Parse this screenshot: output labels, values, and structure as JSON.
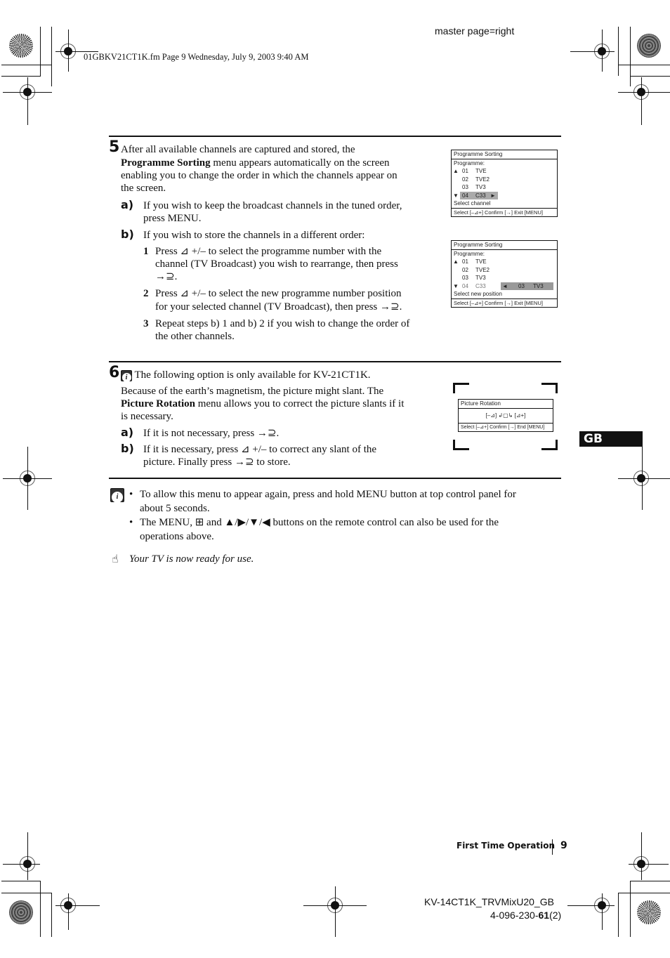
{
  "header": {
    "file_info": "01GBKV21CT1K.fm  Page 9  Wednesday, July 9, 2003  9:40 AM",
    "master_page": "master page=right"
  },
  "step5": {
    "number": "5",
    "intro_pre": "After all available channels are captured and stored, the",
    "intro_bold": "Programme Sorting",
    "intro_post1": " menu appears automatically on the screen",
    "intro_line3": "enabling you to change the order in which the channels appear on",
    "intro_line4": "the screen.",
    "a_label": "a)",
    "a_line1": "If you wish to keep the broadcast channels in the tuned order,",
    "a_line2": "press MENU.",
    "b_label": "b)",
    "b_text": "If you wish to store the channels in a different order:",
    "substeps": [
      {
        "num": "1",
        "line1": "Press ⊿ +/– to select the programme number with the",
        "line2": "channel (TV Broadcast) you wish to rearrange, then press",
        "line3": "→⊇."
      },
      {
        "num": "2",
        "line1": "Press ⊿ +/– to select the new programme number position",
        "line2": "for your selected channel (TV Broadcast), then press →⊇."
      },
      {
        "num": "3",
        "line1": "Repeat steps b) 1 and b) 2 if you wish to change the order of",
        "line2": "the other channels."
      }
    ]
  },
  "osd1": {
    "title": "Programme Sorting",
    "heading": "Programme:",
    "rows": [
      {
        "num": "01",
        "name": "TVE"
      },
      {
        "num": "02",
        "name": "TVE2"
      },
      {
        "num": "03",
        "name": "TV3"
      },
      {
        "num": "04",
        "name": "C33"
      }
    ],
    "status": "Select channel",
    "footer": "Select [–⊿+]  Confirm [→]  Exit [MENU]"
  },
  "osd2": {
    "title": "Programme Sorting",
    "heading": "Programme:",
    "rows": [
      {
        "num": "01",
        "name": "TVE"
      },
      {
        "num": "02",
        "name": "TVE2"
      },
      {
        "num": "03",
        "name": "TV3"
      },
      {
        "num": "04",
        "name": "C33"
      }
    ],
    "target_num": "03",
    "target_name": "TV3",
    "status": "Select new position",
    "footer": "Select [–⊿+]  Confirm [→]  Exit [MENU]"
  },
  "step6": {
    "number": "6",
    "note": "The following option is only available for KV-21CT1K.",
    "line1": "Because of the earth’s magnetism, the picture might slant. The",
    "line2_bold": "Picture Rotation",
    "line2_post": " menu allows you to correct the picture slants if it",
    "line3": "is necessary.",
    "a_label": "a)",
    "a_text": "If it is not necessary, press →⊇.",
    "b_label": "b)",
    "b_line1": "If it is necessary, press ⊿ +/– to correct any slant of the",
    "b_line2": "picture. Finally press →⊇ to store."
  },
  "osd3": {
    "title": "Picture Rotation",
    "control": "[–⊿] ↲▢↳ [⊿+]",
    "footer": "Select [–⊿+]  Confirm [→]  End [MENU]"
  },
  "notes": {
    "bullet1_line1": "To allow this menu to appear again, press and hold MENU button at top control panel for",
    "bullet1_line2": "about 5 seconds.",
    "bullet2_line1": "The MENU, ⊞ and ▲/▶/▼/◀ buttons on the remote control can also be used for the",
    "bullet2_line2": "operations above.",
    "ready": "Your TV is now ready for use."
  },
  "side_tab": "GB",
  "footer": {
    "section": "First Time Operation",
    "page": "9",
    "model": "KV-14CT1K_TRVMixU20_GB",
    "code_pre": "4-096-230-",
    "code_bold": "61",
    "code_post": "(2)"
  }
}
